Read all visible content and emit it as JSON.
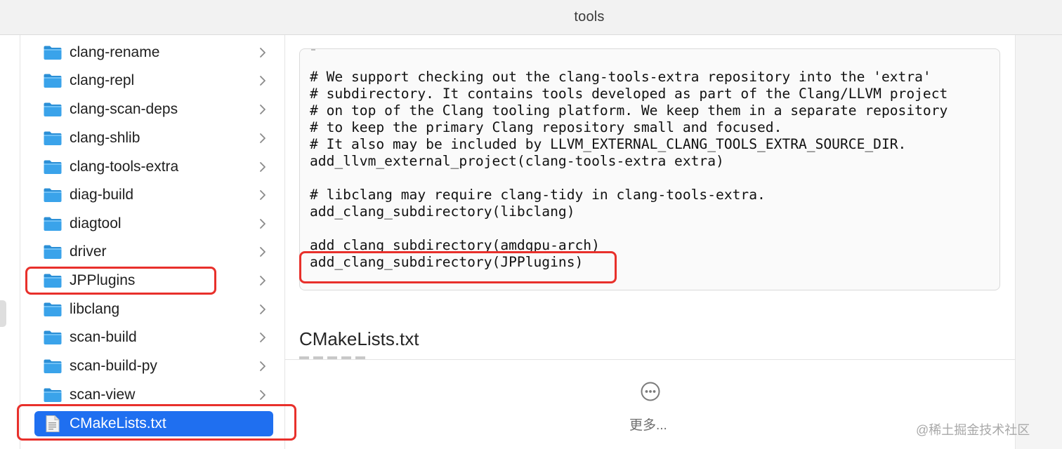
{
  "window": {
    "title": "tools"
  },
  "sidebar": {
    "items": [
      {
        "label": "clang-rename",
        "kind": "folder"
      },
      {
        "label": "clang-repl",
        "kind": "folder"
      },
      {
        "label": "clang-scan-deps",
        "kind": "folder"
      },
      {
        "label": "clang-shlib",
        "kind": "folder"
      },
      {
        "label": "clang-tools-extra",
        "kind": "folder"
      },
      {
        "label": "diag-build",
        "kind": "folder"
      },
      {
        "label": "diagtool",
        "kind": "folder"
      },
      {
        "label": "driver",
        "kind": "folder"
      },
      {
        "label": "JPPlugins",
        "kind": "folder",
        "highlighted": true
      },
      {
        "label": "libclang",
        "kind": "folder"
      },
      {
        "label": "scan-build",
        "kind": "folder"
      },
      {
        "label": "scan-build-py",
        "kind": "folder"
      },
      {
        "label": "scan-view",
        "kind": "folder"
      },
      {
        "label": "CMakeLists.txt",
        "kind": "file",
        "selected": true,
        "highlighted": true
      }
    ]
  },
  "preview": {
    "code_lines": [
      "# We support checking out the clang-tools-extra repository into the 'extra'",
      "# subdirectory. It contains tools developed as part of the Clang/LLVM project",
      "# on top of the Clang tooling platform. We keep them in a separate repository",
      "# to keep the primary Clang repository small and focused.",
      "# It also may be included by LLVM_EXTERNAL_CLANG_TOOLS_EXTRA_SOURCE_DIR.",
      "add_llvm_external_project(clang-tools-extra extra)",
      "",
      "# libclang may require clang-tidy in clang-tools-extra.",
      "add_clang_subdirectory(libclang)",
      "",
      "add_clang_subdirectory(amdgpu-arch)",
      "add_clang_subdirectory(JPPlugins)"
    ],
    "file_name": "CMakeLists.txt",
    "more_label": "更多..."
  },
  "watermark": "@稀土掘金技术社区",
  "colors": {
    "folder": "#3aa3ea",
    "selection": "#1f6ff0",
    "annotation": "#e8302b"
  },
  "icons": {
    "folder": "folder-icon",
    "file": "document-icon",
    "chevron": "chevron-right-icon",
    "more": "ellipsis-circle-icon"
  }
}
